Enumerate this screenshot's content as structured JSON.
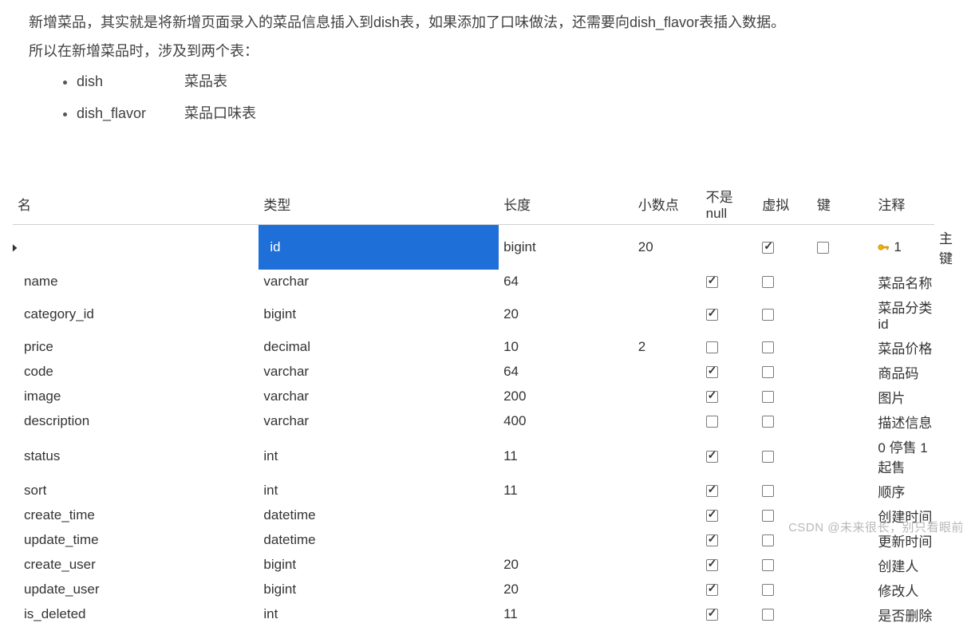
{
  "intro": {
    "line1": "新增菜品，其实就是将新增页面录入的菜品信息插入到dish表，如果添加了口味做法，还需要向dish_flavor表插入数据。",
    "line2": "所以在新增菜品时，涉及到两个表：",
    "tables": [
      {
        "name": "dish",
        "desc": "菜品表"
      },
      {
        "name": "dish_flavor",
        "desc": "菜品口味表"
      }
    ]
  },
  "columns": {
    "name": "名",
    "type": "类型",
    "length": "长度",
    "decimal": "小数点",
    "notnull": "不是 null",
    "virtual": "虚拟",
    "key": "键",
    "comment": "注释"
  },
  "rows": [
    {
      "name": "id",
      "type": "bigint",
      "len": "20",
      "dec": "",
      "nn": true,
      "vir": false,
      "key": "1",
      "comment": "主键",
      "selected": true
    },
    {
      "name": "name",
      "type": "varchar",
      "len": "64",
      "dec": "",
      "nn": true,
      "vir": false,
      "key": "",
      "comment": "菜品名称"
    },
    {
      "name": "category_id",
      "type": "bigint",
      "len": "20",
      "dec": "",
      "nn": true,
      "vir": false,
      "key": "",
      "comment": "菜品分类id"
    },
    {
      "name": "price",
      "type": "decimal",
      "len": "10",
      "dec": "2",
      "nn": false,
      "vir": false,
      "key": "",
      "comment": "菜品价格"
    },
    {
      "name": "code",
      "type": "varchar",
      "len": "64",
      "dec": "",
      "nn": true,
      "vir": false,
      "key": "",
      "comment": "商品码"
    },
    {
      "name": "image",
      "type": "varchar",
      "len": "200",
      "dec": "",
      "nn": true,
      "vir": false,
      "key": "",
      "comment": "图片"
    },
    {
      "name": "description",
      "type": "varchar",
      "len": "400",
      "dec": "",
      "nn": false,
      "vir": false,
      "key": "",
      "comment": "描述信息"
    },
    {
      "name": "status",
      "type": "int",
      "len": "11",
      "dec": "",
      "nn": true,
      "vir": false,
      "key": "",
      "comment": "0 停售 1 起售"
    },
    {
      "name": "sort",
      "type": "int",
      "len": "11",
      "dec": "",
      "nn": true,
      "vir": false,
      "key": "",
      "comment": "顺序"
    },
    {
      "name": "create_time",
      "type": "datetime",
      "len": "",
      "dec": "",
      "nn": true,
      "vir": false,
      "key": "",
      "comment": "创建时间"
    },
    {
      "name": "update_time",
      "type": "datetime",
      "len": "",
      "dec": "",
      "nn": true,
      "vir": false,
      "key": "",
      "comment": "更新时间"
    },
    {
      "name": "create_user",
      "type": "bigint",
      "len": "20",
      "dec": "",
      "nn": true,
      "vir": false,
      "key": "",
      "comment": "创建人"
    },
    {
      "name": "update_user",
      "type": "bigint",
      "len": "20",
      "dec": "",
      "nn": true,
      "vir": false,
      "key": "",
      "comment": "修改人"
    },
    {
      "name": "is_deleted",
      "type": "int",
      "len": "11",
      "dec": "",
      "nn": true,
      "vir": false,
      "key": "",
      "comment": "是否删除"
    }
  ],
  "watermark": "CSDN @未来很长，别只看眼前"
}
